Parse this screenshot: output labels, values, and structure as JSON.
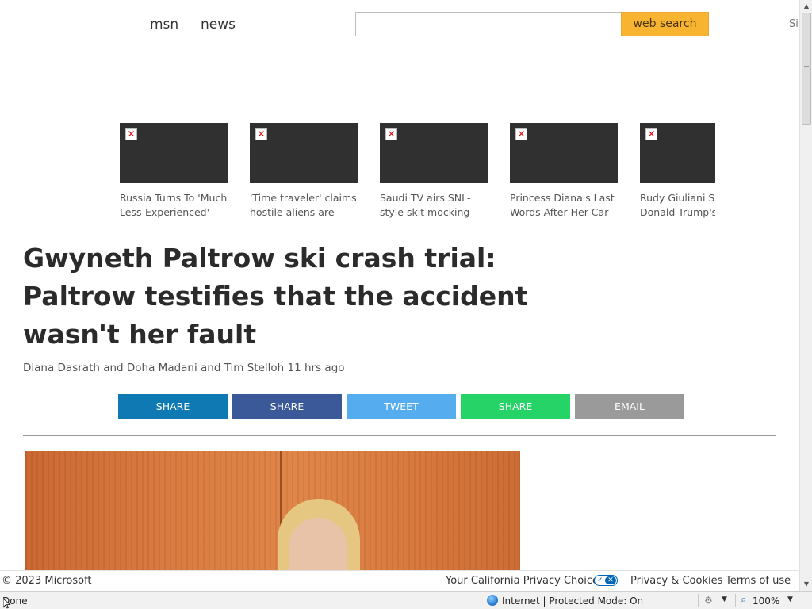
{
  "header": {
    "brand": "msn",
    "section": "news",
    "search": {
      "value": "",
      "button_label": "web search"
    },
    "signin_label": "Sig"
  },
  "carousel": [
    {
      "caption": "Russia Turns To 'Much Less-Experienced' Ally"
    },
    {
      "caption": "'Time traveler' claims hostile aliens are"
    },
    {
      "caption": "Saudi TV airs SNL-style skit mocking Joe Biden,"
    },
    {
      "caption": "Princess Diana's Last Words After Her Car"
    },
    {
      "caption": "Rudy Giuliani Sai Donald Trump's"
    }
  ],
  "article": {
    "headline": "Gwyneth Paltrow ski crash trial: Paltrow testifies that the accident wasn't her fault",
    "byline": "Diana Dasrath and Doha Madani and Tim Stelloh 11 hrs ago"
  },
  "share_buttons": [
    {
      "label": "SHARE",
      "color": "#0e79b2"
    },
    {
      "label": "SHARE",
      "color": "#3b5998"
    },
    {
      "label": "TWEET",
      "color": "#55acee"
    },
    {
      "label": "SHARE",
      "color": "#25d366"
    },
    {
      "label": "EMAIL",
      "color": "#9a9a9a"
    }
  ],
  "footer": {
    "copyright": "© 2023 Microsoft",
    "ca_privacy": "Your California Privacy Choices",
    "privacy": "Privacy & Cookies",
    "terms": "Terms of use"
  },
  "statusbar": {
    "status": "Done",
    "zone": "Internet | Protected Mode: On",
    "zoom": "100%"
  },
  "colors": {
    "search_button": "#f8b431",
    "privacy_toggle": "#0067b8"
  }
}
